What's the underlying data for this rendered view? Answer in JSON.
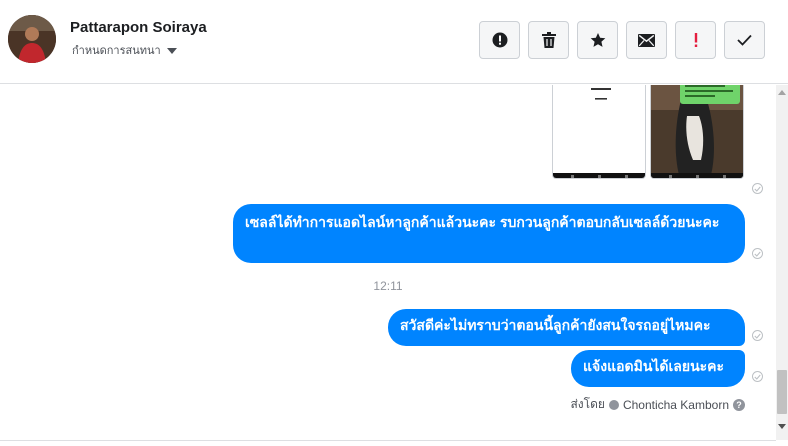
{
  "header": {
    "contact_name": "Pattarapon Soiraya",
    "subtitle": "กำหนดการสนทนา",
    "toolbar": [
      {
        "name": "report-button",
        "icon": "alert-circle-icon"
      },
      {
        "name": "delete-button",
        "icon": "trash-icon"
      },
      {
        "name": "star-button",
        "icon": "star-icon"
      },
      {
        "name": "mail-button",
        "icon": "envelope-icon"
      },
      {
        "name": "priority-button",
        "icon": "exclamation-icon"
      },
      {
        "name": "done-button",
        "icon": "checkmark-icon"
      }
    ]
  },
  "thread": {
    "messages": [
      {
        "text": "เซลล์ได้ทำการแอดไลน์หาลูกค้าแล้วนะคะ รบกวนลูกค้าตอบกลับเซลล์ด้วยนะคะ"
      },
      {
        "text": "สวัสดีค่ะไม่ทราบว่าตอนนี้ลูกค้ายังสนใจรถอยู่ไหมคะ"
      },
      {
        "text": "แจ้งแอดมินได้เลยนะคะ"
      }
    ],
    "timestamp": "12:11",
    "sent_by_label": "ส่งโดย",
    "sent_by_name": "Chonticha Kamborn",
    "help_icon": "?"
  },
  "colors": {
    "bubble": "#0084ff",
    "toolbar_alert": "#e41e3f"
  }
}
